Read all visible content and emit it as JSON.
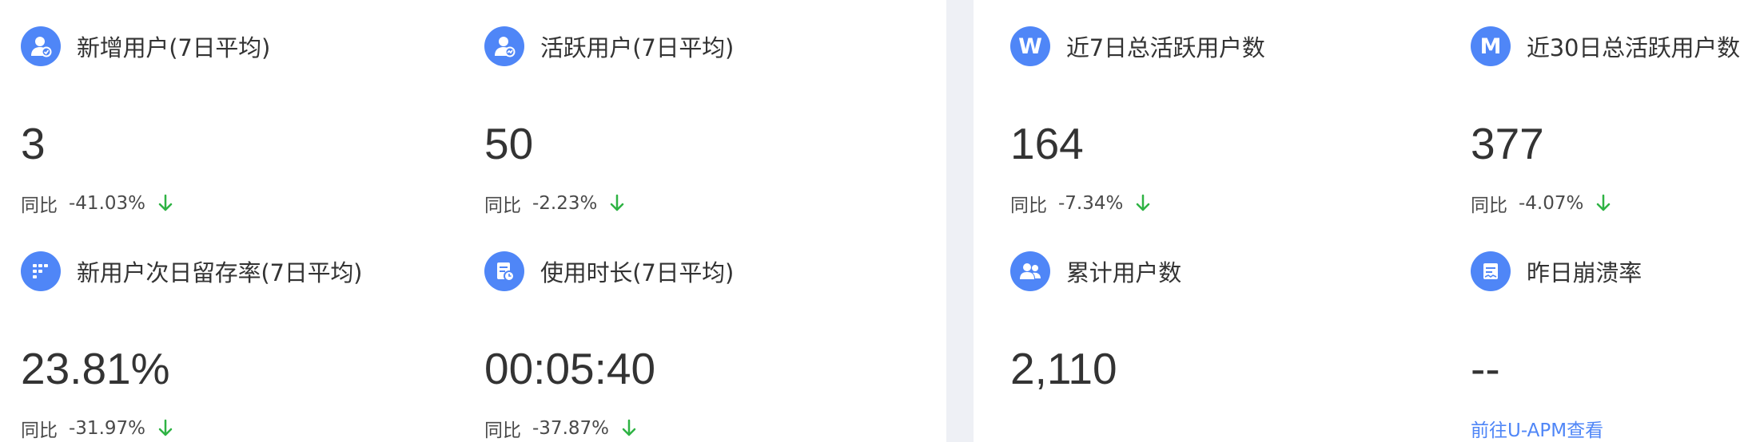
{
  "left_panel": {
    "cards": [
      {
        "title": "新增用户(7日平均)",
        "value": "3",
        "compare_label": "同比",
        "compare_value": "-41.03%",
        "trend": "down",
        "icon": "new-user-icon"
      },
      {
        "title": "活跃用户(7日平均)",
        "value": "50",
        "compare_label": "同比",
        "compare_value": "-2.23%",
        "trend": "down",
        "icon": "active-user-icon"
      },
      {
        "title": "新用户次日留存率(7日平均)",
        "value": "23.81%",
        "compare_label": "同比",
        "compare_value": "-31.97%",
        "trend": "down",
        "icon": "retention-icon"
      },
      {
        "title": "使用时长(7日平均)",
        "value": "00:05:40",
        "compare_label": "同比",
        "compare_value": "-37.87%",
        "trend": "down",
        "icon": "usage-duration-icon"
      }
    ]
  },
  "right_panel": {
    "cards": [
      {
        "title": "近7日总活跃用户数",
        "value": "164",
        "compare_label": "同比",
        "compare_value": "-7.34%",
        "trend": "down",
        "icon": "week-icon",
        "icon_letter": "W"
      },
      {
        "title": "近30日总活跃用户数",
        "value": "377",
        "compare_label": "同比",
        "compare_value": "-4.07%",
        "trend": "down",
        "icon": "month-icon",
        "icon_letter": "M"
      },
      {
        "title": "累计用户数",
        "value": "2,110",
        "icon": "total-users-icon"
      },
      {
        "title": "昨日崩溃率",
        "value": "--",
        "link_text": "前往U-APM查看",
        "icon": "crash-report-icon"
      }
    ]
  },
  "colors": {
    "accent": "#4f86f7",
    "trend_down": "#2fb344",
    "divider": "#eef0f5",
    "text": "#333333"
  }
}
